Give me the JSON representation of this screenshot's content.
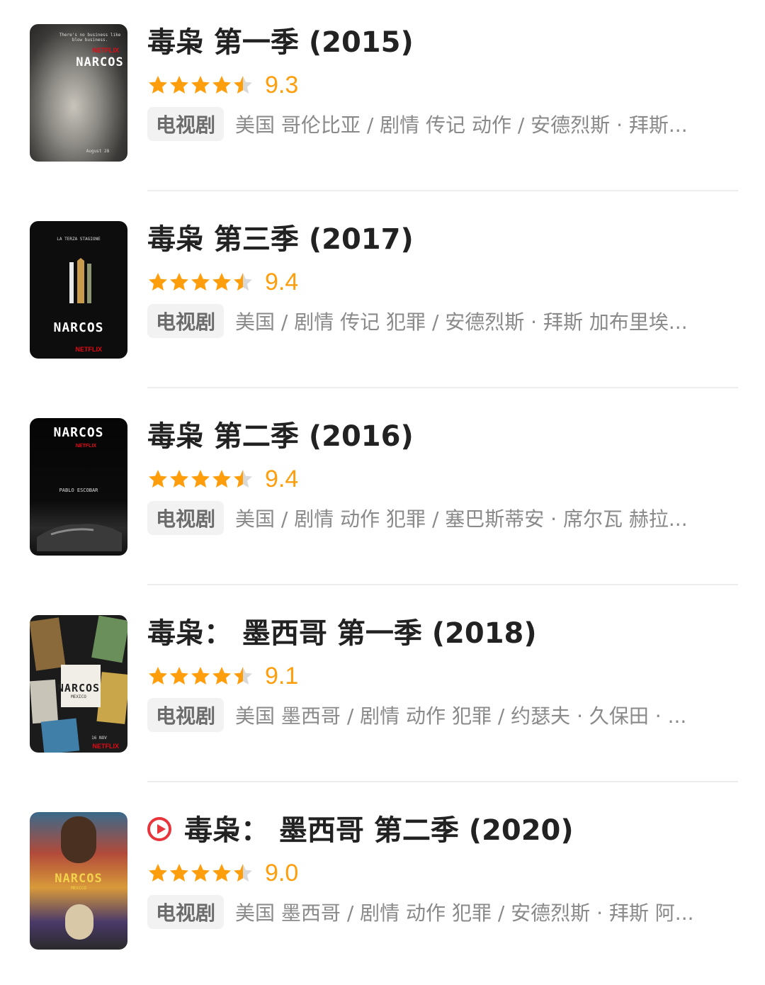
{
  "items": [
    {
      "title": "毒枭 第一季 (2015)",
      "rating": 4.5,
      "score": "9.3",
      "tag": "电视剧",
      "desc": "美国 哥伦比亚 / 剧情 传记 动作 / 安德烈斯 · 拜斯...",
      "poster": {
        "brand": "NETFLIX",
        "name": "NARCOS",
        "tagline": "There's no business like blow business.",
        "date": "August 28"
      },
      "play": false
    },
    {
      "title": "毒枭 第三季 (2017)",
      "rating": 4.5,
      "score": "9.4",
      "tag": "电视剧",
      "desc": "美国 / 剧情 传记 犯罪 / 安德烈斯 · 拜斯 加布里埃...",
      "poster": {
        "brand": "NETFLIX",
        "name": "NARCOS",
        "tagline": "LA TERZA STAGIONE",
        "date": ""
      },
      "play": false
    },
    {
      "title": "毒枭 第二季 (2016)",
      "rating": 4.5,
      "score": "9.4",
      "tag": "电视剧",
      "desc": "美国 / 剧情 动作 犯罪 / 塞巴斯蒂安 · 席尔瓦 赫拉...",
      "poster": {
        "brand": "NETFLIX",
        "name": "NARCOS",
        "tagline": "PABLO ESCOBAR",
        "date": ""
      },
      "play": false
    },
    {
      "title": "毒枭： 墨西哥 第一季 (2018)",
      "rating": 4.5,
      "score": "9.1",
      "tag": "电视剧",
      "desc": "美国 墨西哥 / 剧情 动作 犯罪 / 约瑟夫 · 久保田 · ...",
      "poster": {
        "brand": "NETFLIX",
        "name": "NARCOS",
        "tagline": "MEXICO",
        "date": "16 NOV"
      },
      "play": false
    },
    {
      "title": "毒枭： 墨西哥 第二季 (2020)",
      "rating": 4.5,
      "score": "9.0",
      "tag": "电视剧",
      "desc": "美国 墨西哥 / 剧情 动作 犯罪 / 安德烈斯 · 拜斯 阿...",
      "poster": {
        "brand": "",
        "name": "NARCOS",
        "tagline": "MEXICO",
        "date": ""
      },
      "play": true
    }
  ],
  "colors": {
    "star": "#ff9e0d",
    "star_empty": "#d9d9d9",
    "play": "#e8353b"
  },
  "icons": {
    "star": "star-icon",
    "play": "play-icon"
  }
}
